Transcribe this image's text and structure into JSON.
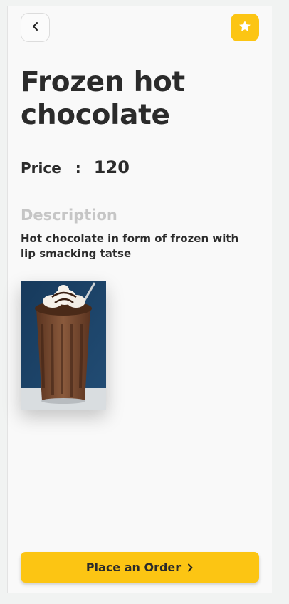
{
  "header": {
    "back_icon": "chevron-left-icon",
    "favorite_icon": "star-icon",
    "accent_color": "#fcc513"
  },
  "product": {
    "title": "Frozen hot chocolate",
    "price_label": "Price",
    "price_separator": ":",
    "price_value": "120",
    "description_heading": "Description",
    "description_text": "Hot chocolate in form of frozen with lip smacking tatse",
    "image_subject": "frozen-hot-chocolate-glass"
  },
  "footer": {
    "order_label": "Place an Order",
    "order_icon": "chevron-right-icon"
  }
}
